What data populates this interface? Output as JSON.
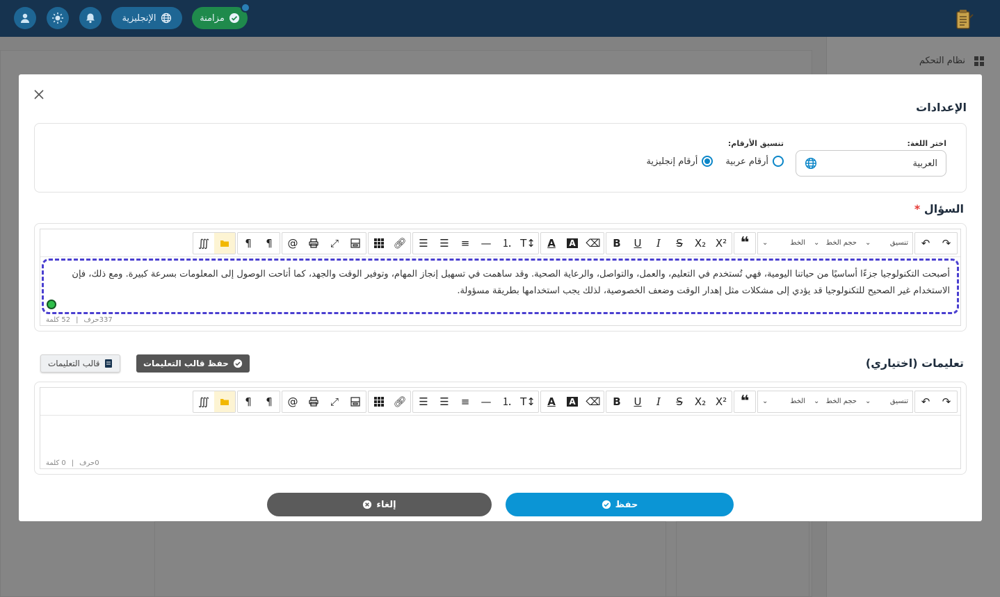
{
  "topbar": {
    "sync_label": "مزامنة",
    "language_label": "الإنجليزية"
  },
  "background": {
    "sidebar_title": "نظام التحكم"
  },
  "modal": {
    "title": "الإعدادات",
    "settings": {
      "language_label": "اختر اللغة:",
      "language_value": "العربية",
      "number_format_label": "تنسيق الأرقام:",
      "number_options": [
        {
          "label": "أرقام عربية",
          "selected": false
        },
        {
          "label": "أرقام إنجليزية",
          "selected": true
        }
      ]
    },
    "question": {
      "title": "السؤال",
      "required_mark": "*",
      "content": "أصبحت التكنولوجيا جزءًا أساسيًا من حياتنا اليومية، فهي تُستخدم في التعليم، والعمل، والتواصل، والرعاية الصحية. وقد ساهمت في تسهيل إنجاز المهام، وتوفير الوقت والجهد، كما أتاحت الوصول إلى المعلومات بسرعة كبيرة. ومع ذلك، فإن الاستخدام غير الصحيح للتكنولوجيا قد يؤدي إلى مشكلات مثل إهدار الوقت وضعف الخصوصية، لذلك يجب استخدامها بطريقة مسؤولة.",
      "char_count": "337حرف",
      "word_count": "52 كلمة"
    },
    "instructions": {
      "title": "تعليمات (اختياري)",
      "save_template_label": "حفظ قالب التعليمات",
      "load_template_label": "قالب التعليمات",
      "char_count": "0حرف",
      "word_count": "0 كلمة"
    },
    "toolbar": {
      "format_select": "تنسيق",
      "size_select": "حجم الخط",
      "font_select": "الخط"
    },
    "save_label": "حفظ",
    "cancel_label": "إلغاء"
  },
  "colors": {
    "topbar": "#16334f",
    "accent": "#0b95d5",
    "sync": "#1f8a4c",
    "dashed_border": "#4a3fd0"
  }
}
